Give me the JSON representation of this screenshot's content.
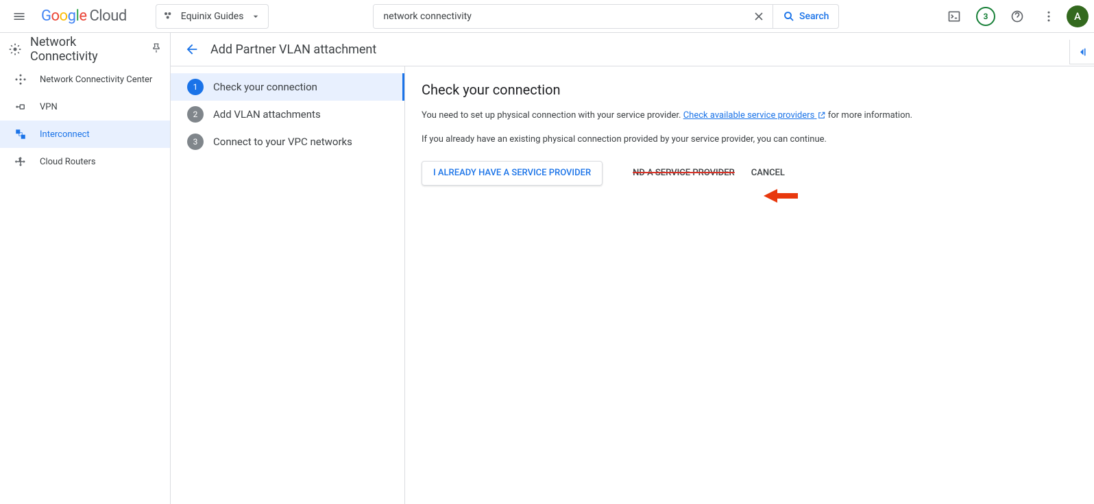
{
  "header": {
    "project": "Equinix Guides",
    "search_value": "network connectivity",
    "search_button": "Search",
    "notif_count": "3",
    "avatar_letter": "A"
  },
  "sidebar": {
    "title": "Network Connectivity",
    "items": [
      {
        "label": "Network Connectivity Center"
      },
      {
        "label": "VPN"
      },
      {
        "label": "Interconnect"
      },
      {
        "label": "Cloud Routers"
      }
    ]
  },
  "page": {
    "title": "Add Partner VLAN attachment",
    "steps": [
      {
        "n": "1",
        "label": "Check your connection"
      },
      {
        "n": "2",
        "label": "Add VLAN attachments"
      },
      {
        "n": "3",
        "label": "Connect to your VPC networks"
      }
    ],
    "panel": {
      "heading": "Check your connection",
      "p1a": "You need to set up physical connection with your service provider. ",
      "link": "Check available service providers",
      "p1b": " for more information.",
      "p2": "If you already have an existing physical connection provided by your service provider, you can continue.",
      "btn_primary": "I ALREADY HAVE A SERVICE PROVIDER",
      "btn_find": "ND A SERVICE PROVIDER",
      "btn_cancel": "CANCEL"
    }
  }
}
